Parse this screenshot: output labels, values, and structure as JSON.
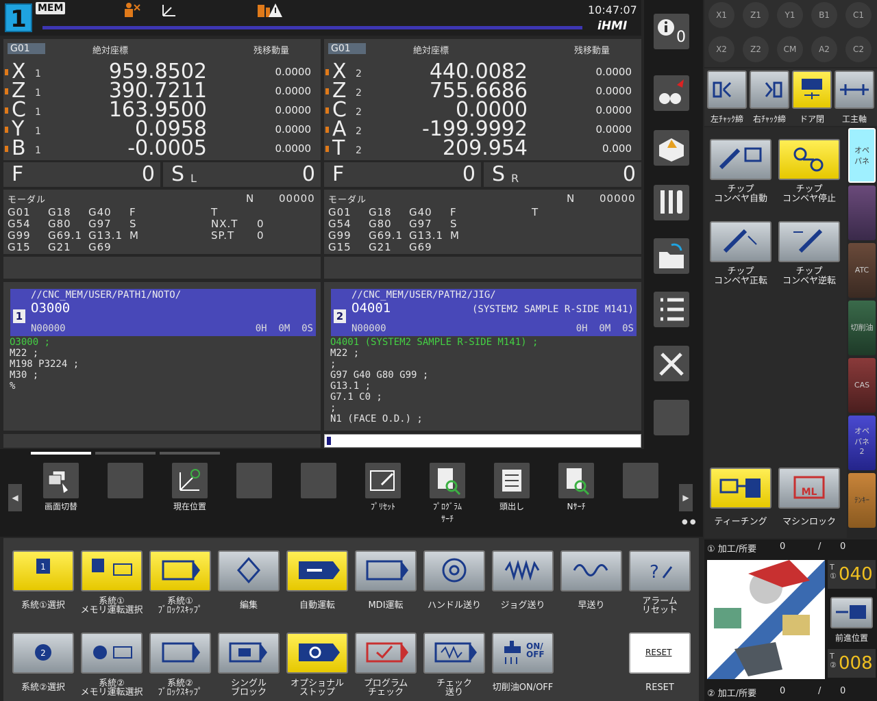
{
  "header": {
    "path_number": "1",
    "mode": "MEM",
    "time": "10:47:07",
    "brand": "iHMI"
  },
  "path1": {
    "gcode": "G01",
    "abs_label": "絶対座標",
    "rem_label": "残移動量",
    "axes": [
      {
        "name": "X",
        "sub": "1",
        "value": "959.8502",
        "remaining": "0.0000"
      },
      {
        "name": "Z",
        "sub": "1",
        "value": "390.7211",
        "remaining": "0.0000"
      },
      {
        "name": "C",
        "sub": "1",
        "value": "163.9500",
        "remaining": "0.0000"
      },
      {
        "name": "Y",
        "sub": "1",
        "value": "0.0958",
        "remaining": "0.0000"
      },
      {
        "name": "B",
        "sub": "1",
        "value": "-0.0005",
        "remaining": "0.0000"
      }
    ],
    "f_label": "F",
    "f_value": "0",
    "s_label": "S",
    "s_sub": "L",
    "s_value": "0",
    "modal": {
      "title": "モーダル",
      "n_label": "N",
      "n_value": "00000",
      "col1": [
        "G01",
        "G54",
        "G99",
        "G15"
      ],
      "col2": [
        "G18",
        "G80",
        "G69.1",
        "G21"
      ],
      "col3": [
        "G40",
        "G97",
        "G13.1",
        "G69"
      ],
      "col4": [
        "F",
        "S",
        "M"
      ],
      "t_label": "T",
      "nxt_label": "NX.T",
      "nxt_value": "0",
      "spt_label": "SP.T",
      "spt_value": "0"
    },
    "program": {
      "path": "//CNC_MEM/USER/PATH1/NOTO/",
      "num": "1",
      "name": "O3000",
      "comment": "",
      "nline": "N00000",
      "time": "0H  0M  0S",
      "lines": [
        "O3000 ;",
        "M22 ;",
        "M198 P3224 ;",
        "M30 ;",
        "%"
      ]
    }
  },
  "path2": {
    "gcode": "G01",
    "abs_label": "絶対座標",
    "rem_label": "残移動量",
    "axes": [
      {
        "name": "X",
        "sub": "2",
        "value": "440.0082",
        "remaining": "0.0000"
      },
      {
        "name": "Z",
        "sub": "2",
        "value": "755.6686",
        "remaining": "0.0000"
      },
      {
        "name": "C",
        "sub": "2",
        "value": "0.0000",
        "remaining": "0.0000"
      },
      {
        "name": "A",
        "sub": "2",
        "value": "-199.9992",
        "remaining": "0.0000"
      },
      {
        "name": "T",
        "sub": "2",
        "value": "209.954",
        "remaining": "0.000"
      }
    ],
    "f_label": "F",
    "f_value": "0",
    "s_label": "S",
    "s_sub": "R",
    "s_value": "0",
    "modal": {
      "title": "モーダル",
      "n_label": "N",
      "n_value": "00000",
      "col1": [
        "G01",
        "G54",
        "G99",
        "G15"
      ],
      "col2": [
        "G18",
        "G80",
        "G69.1",
        "G21"
      ],
      "col3": [
        "G40",
        "G97",
        "G13.1",
        "G69"
      ],
      "col4": [
        "F",
        "S",
        "M"
      ],
      "t_label": "T"
    },
    "program": {
      "path": "//CNC_MEM/USER/PATH2/JIG/",
      "num": "2",
      "name": "O4001",
      "comment": "(SYSTEM2 SAMPLE R-SIDE M141)",
      "nline": "N00000",
      "time": "0H  0M  0S",
      "lines": [
        "O4001 (SYSTEM2 SAMPLE R-SIDE M141) ;",
        "M22 ;",
        ";",
        "G97 G40 G80 G99 ;",
        "G13.1 ;",
        "G7.1 C0 ;",
        ";",
        "N1 (FACE O.D.) ;"
      ]
    }
  },
  "softkeys": {
    "k1": "画面切替",
    "k3": "現在位置",
    "k6": "ﾌﾟﾘｾｯﾄ",
    "k7a": "ﾌﾟﾛｸﾞﾗﾑ",
    "k7b": "ｻｰﾁ",
    "k8": "頭出し",
    "k9": "Nｻｰﾁ"
  },
  "info_count": "0",
  "machine_buttons": {
    "row1": [
      "系統①選択",
      "系統①\nメモリ運転選択",
      "系統①\nﾌﾞﾛｯｸｽｷｯﾌﾟ",
      "編集",
      "自動運転",
      "MDI運転",
      "ハンドル送り",
      "ジョグ送り",
      "早送り",
      "アラーム\nリセット"
    ],
    "row2": [
      "系統②選択",
      "系統②\nメモリ運転選択",
      "系統②\nﾌﾞﾛｯｸｽｷｯﾌﾟ",
      "シングル\nブロック",
      "オプショナル\nストップ",
      "プログラム\nチェック",
      "チェック\n送り",
      "切削油ON/OFF",
      "",
      "RESET"
    ],
    "reset_icon_text": "RESET",
    "onoff_text": "ON/\nOFF"
  },
  "right_panel": {
    "axis_buttons_row1": [
      "X1",
      "Z1",
      "Y1",
      "B1",
      "C1"
    ],
    "axis_buttons_row2": [
      "X2",
      "Z2",
      "CM",
      "A2",
      "C2"
    ],
    "tools": [
      "左ﾁｬｯｸ締",
      "右ﾁｬｯｸ締",
      "ドア閉",
      "工主軸"
    ],
    "chip1a": "チップ",
    "chip1b": "コンベヤ自動",
    "chip2a": "チップ",
    "chip2b": "コンベヤ停止",
    "chip3a": "チップ",
    "chip3b": "コンベヤ正転",
    "chip4a": "チップ",
    "chip4b": "コンベヤ逆転",
    "teach": "ティーチング",
    "machinelock": "マシンロック",
    "side_tabs": [
      "オペ\nパネ",
      "",
      "ATC",
      "切削油",
      "CAS",
      "オペ\nパネ\n2",
      "ﾃﾝｷｰ"
    ],
    "count1_label": "① 加工/所要",
    "count1_a": "0",
    "count1_sep": "/",
    "count1_b": "0",
    "count2_label": "② 加工/所要",
    "count2_a": "0",
    "count2_sep": "/",
    "count2_b": "0",
    "tool1": "040",
    "tool2": "008",
    "advance_label": "前進位置"
  }
}
